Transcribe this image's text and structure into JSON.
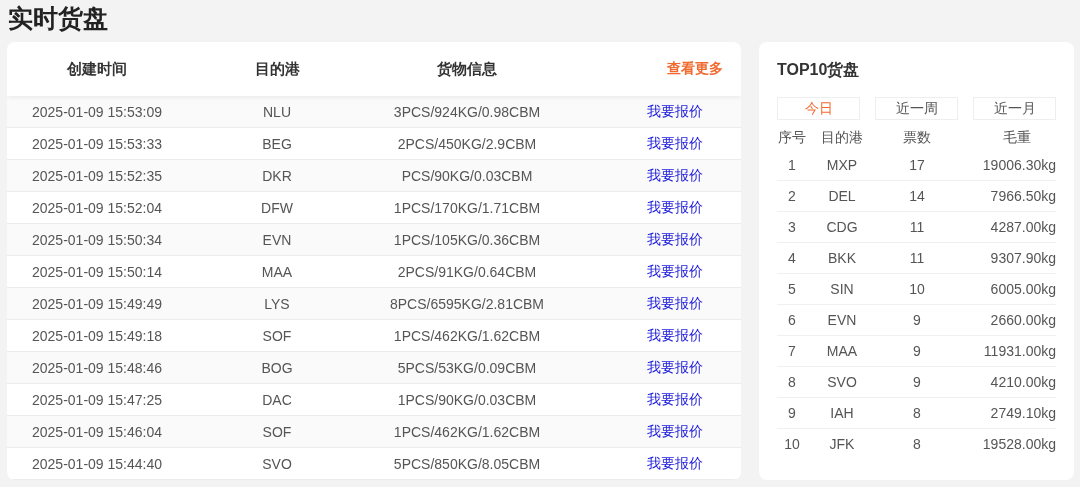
{
  "page_title": "实时货盘",
  "cargo_table": {
    "columns": [
      "创建时间",
      "目的港",
      "货物信息"
    ],
    "more_link": "查看更多",
    "rows": [
      {
        "time": "2025-01-09 15:53:09",
        "port": "NLU",
        "cargo": "3PCS/924KG/0.98CBM",
        "action": "我要报价"
      },
      {
        "time": "2025-01-09 15:53:33",
        "port": "BEG",
        "cargo": "2PCS/450KG/2.9CBM",
        "action": "我要报价"
      },
      {
        "time": "2025-01-09 15:52:35",
        "port": "DKR",
        "cargo": "PCS/90KG/0.03CBM",
        "action": "我要报价"
      },
      {
        "time": "2025-01-09 15:52:04",
        "port": "DFW",
        "cargo": "1PCS/170KG/1.71CBM",
        "action": "我要报价"
      },
      {
        "time": "2025-01-09 15:50:34",
        "port": "EVN",
        "cargo": "1PCS/105KG/0.36CBM",
        "action": "我要报价"
      },
      {
        "time": "2025-01-09 15:50:14",
        "port": "MAA",
        "cargo": "2PCS/91KG/0.64CBM",
        "action": "我要报价"
      },
      {
        "time": "2025-01-09 15:49:49",
        "port": "LYS",
        "cargo": "8PCS/6595KG/2.81CBM",
        "action": "我要报价"
      },
      {
        "time": "2025-01-09 15:49:18",
        "port": "SOF",
        "cargo": "1PCS/462KG/1.62CBM",
        "action": "我要报价"
      },
      {
        "time": "2025-01-09 15:48:46",
        "port": "BOG",
        "cargo": "5PCS/53KG/0.09CBM",
        "action": "我要报价"
      },
      {
        "time": "2025-01-09 15:47:25",
        "port": "DAC",
        "cargo": "1PCS/90KG/0.03CBM",
        "action": "我要报价"
      },
      {
        "time": "2025-01-09 15:46:04",
        "port": "SOF",
        "cargo": "1PCS/462KG/1.62CBM",
        "action": "我要报价"
      },
      {
        "time": "2025-01-09 15:44:40",
        "port": "SVO",
        "cargo": "5PCS/850KG/8.05CBM",
        "action": "我要报价"
      }
    ]
  },
  "top10": {
    "title": "TOP10货盘",
    "tabs": [
      {
        "label": "今日",
        "selected": true
      },
      {
        "label": "近一周",
        "selected": false
      },
      {
        "label": "近一月",
        "selected": false
      }
    ],
    "columns": [
      "序号",
      "目的港",
      "票数",
      "毛重"
    ],
    "rows": [
      {
        "rank": "1",
        "port": "MXP",
        "count": "17",
        "weight": "19006.30kg"
      },
      {
        "rank": "2",
        "port": "DEL",
        "count": "14",
        "weight": "7966.50kg"
      },
      {
        "rank": "3",
        "port": "CDG",
        "count": "11",
        "weight": "4287.00kg"
      },
      {
        "rank": "4",
        "port": "BKK",
        "count": "11",
        "weight": "9307.90kg"
      },
      {
        "rank": "5",
        "port": "SIN",
        "count": "10",
        "weight": "6005.00kg"
      },
      {
        "rank": "6",
        "port": "EVN",
        "count": "9",
        "weight": "2660.00kg"
      },
      {
        "rank": "7",
        "port": "MAA",
        "count": "9",
        "weight": "11931.00kg"
      },
      {
        "rank": "8",
        "port": "SVO",
        "count": "9",
        "weight": "4210.00kg"
      },
      {
        "rank": "9",
        "port": "IAH",
        "count": "8",
        "weight": "2749.10kg"
      },
      {
        "rank": "10",
        "port": "JFK",
        "count": "8",
        "weight": "19528.00kg"
      }
    ]
  }
}
